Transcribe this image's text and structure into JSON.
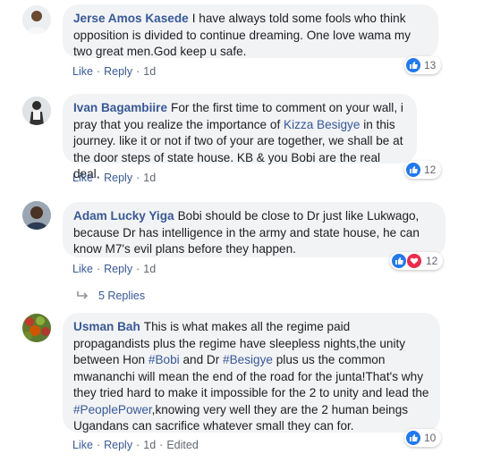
{
  "comments": [
    {
      "author": "Jerse Amos Kasede",
      "text": "I have always told some fools who think opposition is divided to continue dreaming. One love wama my two great men.God keep u safe.",
      "like_label": "Like",
      "reply_label": "Reply",
      "time": "1d",
      "reaction_count": "13",
      "avatar_icon": "person-avatar-icon"
    },
    {
      "author": "Ivan Bagambiire",
      "text_before": "For the first time to comment on your wall, i pray that you realize the importance of",
      "mention": "Kizza Besigye",
      "text_after": "in this journey. like it or not if two of your are together, we shall be at the door steps of state house. KB & you Bobi are the real deal.",
      "like_label": "Like",
      "reply_label": "Reply",
      "time": "1d",
      "reaction_count": "12",
      "avatar_icon": "person-avatar-icon"
    },
    {
      "author": "Adam Lucky Yiga",
      "text": "Bobi should be close to Dr just like Lukwago, because Dr has intelligence in the army and state house, he can know M7's evil plans before they happen.",
      "like_label": "Like",
      "reply_label": "Reply",
      "time": "1d",
      "reaction_count": "12",
      "replies_label": "5 Replies",
      "avatar_icon": "person-avatar-icon"
    },
    {
      "author": "Usman Bah",
      "text_1": "This is what makes all the regime paid propagandists plus the regime have sleepless nights,the unity between Hon",
      "tag_1": "#Bobi",
      "text_2": "and Dr",
      "tag_2": "#Besigye",
      "text_3": "plus us the common mwananchi will mean the end of the road for the junta!That's why they tried hard to make it impossible for the 2 to unity and lead the",
      "tag_3": "#PeoplePower",
      "text_4": ",knowing very well they are the 2 human beings Ugandans can sacrifice whatever small they can for.",
      "like_label": "Like",
      "reply_label": "Reply",
      "time": "1d",
      "edited_label": "Edited",
      "reaction_count": "10",
      "avatar_icon": "fruit-avatar-icon"
    }
  ],
  "colors": {
    "link": "#385898",
    "bubble": "#f2f3f5",
    "meta": "#616770",
    "like_blue": "#2078f4",
    "love_red": "#f0284a"
  }
}
